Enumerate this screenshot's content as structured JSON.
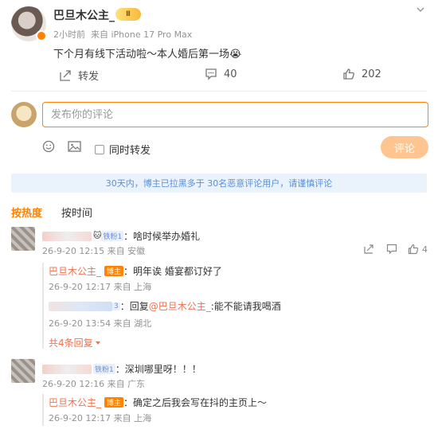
{
  "post": {
    "author": "巴旦木公主_",
    "level_badge": "Ⅱ",
    "time": "2小时前",
    "source": "来自 iPhone 17 Pro Max",
    "text": "下个月有线下活动啦～本人婚后第一场😭",
    "repost_label": "转发",
    "comment_count": "40",
    "like_count": "202"
  },
  "composer": {
    "placeholder": "发布你的评论",
    "repost_checkbox_label": "同时转发",
    "submit_label": "评论"
  },
  "notice": "30天内，博主已拉黑多于 30名恶意评论用户，请谨慎评论",
  "tabs": [
    {
      "label": "按热度",
      "active": true
    },
    {
      "label": "按时间",
      "active": false
    }
  ],
  "comments": [
    {
      "badge": "铁粉1",
      "text": "：啥时候举办婚礼",
      "meta": "26-9-20 12:15 来自 安徽",
      "like_count": "4",
      "replies": [
        {
          "name": "巴旦木公主_",
          "tag": "博主",
          "text": "：明年诶 婚宴都订好了",
          "meta": "26-9-20 12:17 来自 上海"
        },
        {
          "badge": "3",
          "reply_prefix": "：回复",
          "mention": "@巴旦木公主_",
          "text": ":能不能请我喝酒",
          "meta": "26-9-20 13:54 来自 湖北"
        }
      ],
      "more_label": "共4条回复"
    },
    {
      "badge": "铁粉1",
      "text": "：深圳哪里呀！！！",
      "meta": "26-9-20 12:16 来自 广东",
      "replies": [
        {
          "name": "巴旦木公主_",
          "tag": "博主",
          "text": "：确定之后我会写在抖的主页上～",
          "meta": "26-9-20 12:17 来自 上海"
        }
      ]
    }
  ],
  "colors": {
    "accent": "#ff8200",
    "link": "#eb7350",
    "notice_bg": "#eaf3fc"
  }
}
